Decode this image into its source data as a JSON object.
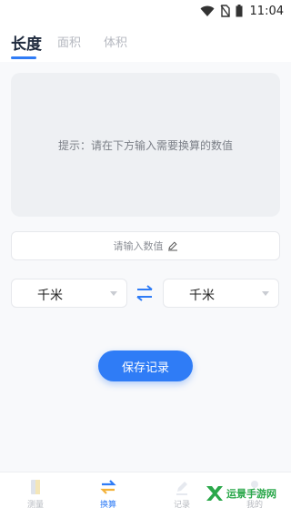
{
  "status_bar": {
    "time": "11:04"
  },
  "tabs": [
    {
      "label": "长度",
      "active": true
    },
    {
      "label": "面积",
      "active": false
    },
    {
      "label": "体积",
      "active": false
    }
  ],
  "display": {
    "hint": "提示：请在下方输入需要换算的数值"
  },
  "input": {
    "placeholder": "请输入数值"
  },
  "units": {
    "from": "千米",
    "to": "千米"
  },
  "save_button": {
    "label": "保存记录"
  },
  "bottom_nav": [
    {
      "label": "测量",
      "icon": "ruler-icon",
      "active": false
    },
    {
      "label": "换算",
      "icon": "swap-icon",
      "active": true
    },
    {
      "label": "记录",
      "icon": "pencil-icon",
      "active": false
    },
    {
      "label": "我的",
      "icon": "user-icon",
      "active": false
    }
  ],
  "watermark": {
    "text": "运景手游网"
  },
  "colors": {
    "accent": "#2f7cf6",
    "background": "#f8f9fb",
    "inactive": "#b6b9bf"
  }
}
